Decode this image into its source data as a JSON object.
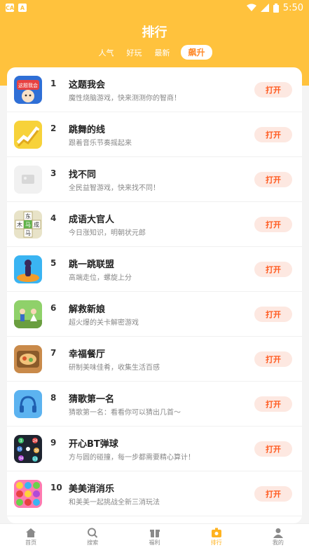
{
  "status_bar": {
    "time": "5:50",
    "left_icons": [
      "CA",
      "A"
    ]
  },
  "header": {
    "title": "排行"
  },
  "tabs": [
    {
      "label": "人气",
      "active": false
    },
    {
      "label": "好玩",
      "active": false
    },
    {
      "label": "最新",
      "active": false
    },
    {
      "label": "飙升",
      "active": true
    }
  ],
  "games": [
    {
      "rank": "1",
      "name": "这题我会",
      "desc": "魔性烧脑游戏，快来测测你的智商！",
      "button": "打开"
    },
    {
      "rank": "2",
      "name": "跳舞的线",
      "desc": "跟着音乐节奏摇起来",
      "button": "打开"
    },
    {
      "rank": "3",
      "name": "找不同",
      "desc": "全民益智游戏，快来找不同！",
      "button": "打开"
    },
    {
      "rank": "4",
      "name": "成语大官人",
      "desc": "今日涨知识，明朝状元郎",
      "button": "打开"
    },
    {
      "rank": "5",
      "name": "跳一跳联盟",
      "desc": "高端走位，螺旋上分",
      "button": "打开"
    },
    {
      "rank": "6",
      "name": "解救新娘",
      "desc": "超火爆的关卡解密游戏",
      "button": "打开"
    },
    {
      "rank": "7",
      "name": "幸福餐厅",
      "desc": "研制美味佳肴，收集生活百感",
      "button": "打开"
    },
    {
      "rank": "8",
      "name": "猜歌第一名",
      "desc": "猜歌第一名：看看你可以猜出几首～",
      "button": "打开"
    },
    {
      "rank": "9",
      "name": "开心BT弹球",
      "desc": "方与圆的碰撞，每一步都需要精心算计！",
      "button": "打开"
    },
    {
      "rank": "10",
      "name": "美美消消乐",
      "desc": "和美美一起挑战全新三消玩法",
      "button": "打开"
    }
  ],
  "icon_tiles": {
    "1": "这题我会",
    "4": [
      "东",
      "木",
      "马",
      "成",
      "功",
      "马"
    ],
    "9": [
      "3",
      "24",
      "16",
      "38",
      "34",
      "13",
      "22"
    ]
  },
  "bottom_nav": [
    {
      "label": "首页",
      "icon": "home-icon",
      "active": false
    },
    {
      "label": "搜索",
      "icon": "search-icon",
      "active": false
    },
    {
      "label": "福利",
      "icon": "gift-icon",
      "active": false
    },
    {
      "label": "排行",
      "icon": "ranking-icon",
      "active": true
    },
    {
      "label": "我的",
      "icon": "user-icon",
      "active": false
    }
  ],
  "colors": {
    "accent": "#ffc23d",
    "button_bg": "#fde8e1",
    "button_text": "#ff5a1f",
    "nav_active": "#ffb320"
  }
}
